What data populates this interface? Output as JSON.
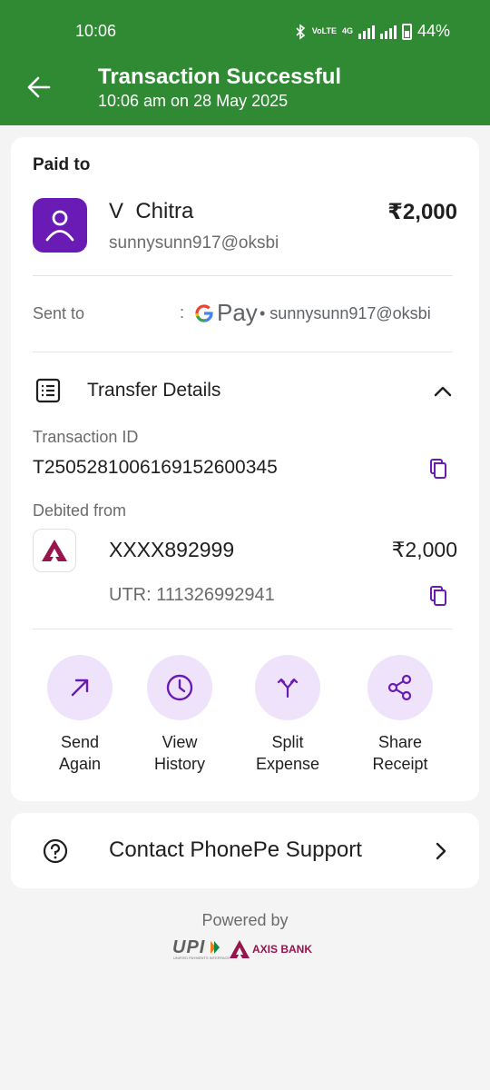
{
  "status_bar": {
    "time": "10:06",
    "network_label": "VoLTE",
    "network_type": "4G",
    "battery": "44%"
  },
  "header": {
    "title": "Transaction Successful",
    "subtitle": "10:06 am on 28 May 2025",
    "background_color": "#2f8a33"
  },
  "payment": {
    "paid_to_label": "Paid to",
    "payee_name": "V  Chitra",
    "payee_upi": "sunnysunn917@oksbi",
    "amount": "₹2,000",
    "avatar_color": "#6a1bb5"
  },
  "sent_to": {
    "label": "Sent to",
    "separator": ":",
    "app_name": "Pay",
    "upi": "• sunnysunn917@oksbi"
  },
  "transfer_details": {
    "label": "Transfer Details",
    "transaction_id_label": "Transaction ID",
    "transaction_id": "T2505281006169152600345",
    "debited_from_label": "Debited from",
    "account_number": "XXXX892999",
    "amount": "₹2,000",
    "utr": "UTR: 111326992941"
  },
  "actions": [
    {
      "line1": "Send",
      "line2": "Again",
      "icon": "arrow-up-right-icon"
    },
    {
      "line1": "View",
      "line2": "History",
      "icon": "clock-icon"
    },
    {
      "line1": "Split",
      "line2": "Expense",
      "icon": "split-icon"
    },
    {
      "line1": "Share",
      "line2": "Receipt",
      "icon": "share-icon"
    }
  ],
  "support": {
    "label": "Contact PhonePe Support"
  },
  "footer": {
    "powered_by": "Powered by",
    "upi_logo_text": "UPI",
    "upi_logo_subtext": "UNIFIED PAYMENTS INTERFACE",
    "bank_logo_text": "AXIS BANK"
  },
  "colors": {
    "accent_purple": "#6a1bb5",
    "action_circle": "#efe2fb",
    "axis_brand": "#97144d"
  }
}
